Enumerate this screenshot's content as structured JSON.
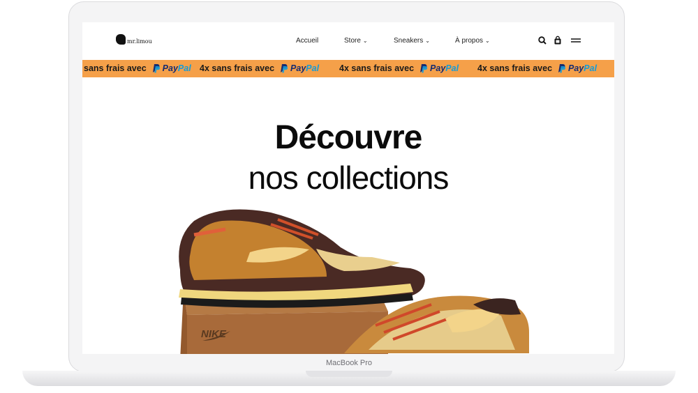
{
  "site": {
    "logo_text": "mr.limou",
    "nav": [
      {
        "label": "Accueil",
        "has_dropdown": false
      },
      {
        "label": "Store",
        "has_dropdown": true
      },
      {
        "label": "Sneakers",
        "has_dropdown": true
      },
      {
        "label": "À propos",
        "has_dropdown": true
      }
    ],
    "icons": [
      "search-icon",
      "bag-icon",
      "menu-icon"
    ]
  },
  "promo": {
    "text": "4x sans frais avec",
    "text_partial": "sans frais avec",
    "paypal_pay": "Pay",
    "paypal_pal": "Pal",
    "background": "#f5a049"
  },
  "hero": {
    "title": "Découvre",
    "subtitle": "nos collections",
    "box_brand": "NIKE"
  },
  "device": {
    "label": "MacBook Pro"
  },
  "colors": {
    "accent": "#f5a049",
    "paypal_dark": "#172c70",
    "paypal_light": "#179bd7"
  }
}
